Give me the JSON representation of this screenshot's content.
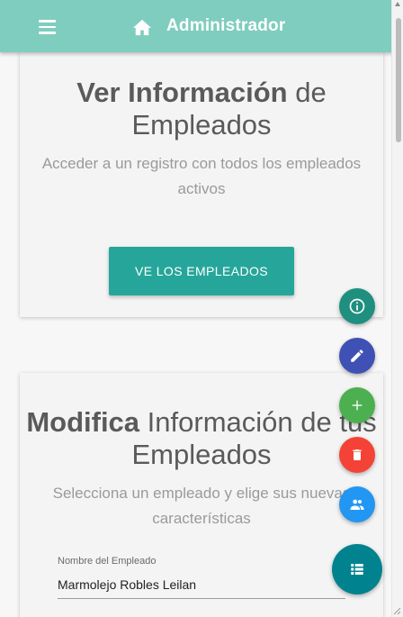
{
  "appbar": {
    "title": "Administrador",
    "menu_icon": "hamburger-menu-icon",
    "home_icon": "home-icon",
    "color": "#7fcdbe"
  },
  "card_view": {
    "title_bold": "Ver Información",
    "title_rest": " de Empleados",
    "subtitle": "Acceder a un registro con todos los empleados activos",
    "button_label": "VE LOS EMPLEADOS",
    "button_color": "#26a69a"
  },
  "card_modify": {
    "title_bold": "Modifica",
    "title_rest": " Información de tus Empleados",
    "subtitle": "Selecciona un empleado y elige sus nuevas características",
    "field_label": "Nombre del Empleado",
    "field_value": "Marmolejo Robles Leilan"
  },
  "fabs": [
    {
      "icon": "info-icon",
      "color": "#1f8f7f"
    },
    {
      "icon": "pencil-icon",
      "color": "#3f51b5"
    },
    {
      "icon": "plus-icon",
      "color": "#4caf50"
    },
    {
      "icon": "trash-icon",
      "color": "#f44336"
    },
    {
      "icon": "people-icon",
      "color": "#2196f3"
    },
    {
      "icon": "list-icon",
      "color": "#00838f"
    }
  ]
}
